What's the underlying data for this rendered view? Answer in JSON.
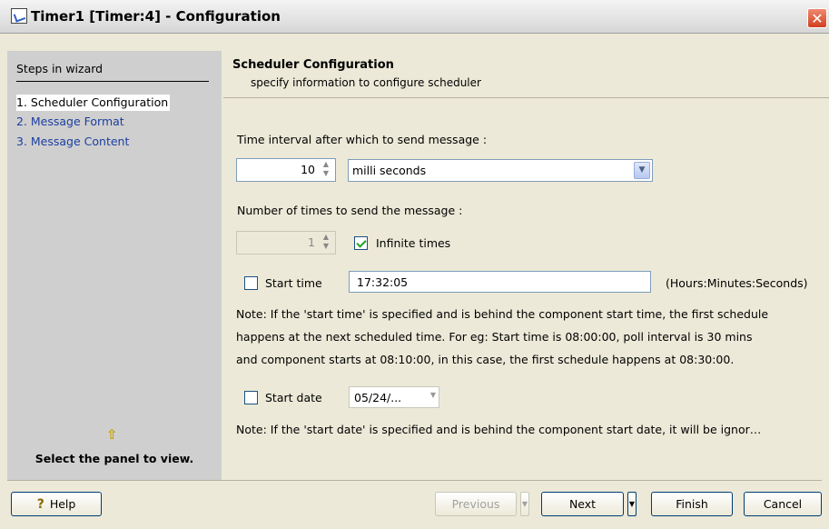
{
  "window": {
    "title": "Timer1 [Timer:4] - Configuration",
    "close_label": "✕"
  },
  "sidebar": {
    "heading": "Steps in wizard",
    "steps": [
      {
        "label": "1. Scheduler Configuration",
        "active": true
      },
      {
        "label": "2. Message Format",
        "active": false
      },
      {
        "label": "3. Message Content",
        "active": false
      }
    ],
    "arrow_icon": "⇧",
    "select_panel_text": "Select the panel to view."
  },
  "header": {
    "title": "Scheduler Configuration",
    "subtitle": "specify information to configure scheduler"
  },
  "form": {
    "interval_label": "Time interval after which to send message :",
    "interval_value": "10",
    "interval_unit": "milli seconds",
    "times_label": "Number of times to send the message :",
    "times_value": "1",
    "infinite_label": "Infinite times",
    "infinite_checked": true,
    "start_time_label": "Start time",
    "start_time_checked": false,
    "start_time_value": "17:32:05",
    "start_time_format": "(Hours:Minutes:Seconds)",
    "start_time_note_lines": [
      "Note: If the 'start time' is specified and is behind the component start time, the first schedule",
      "happens at the next scheduled time. For eg: Start time is 08:00:00, poll interval is 30 mins",
      "and component starts at 08:10:00, in this case, the first schedule happens at 08:30:00."
    ],
    "start_date_label": "Start date",
    "start_date_checked": false,
    "start_date_value": "05/24/...",
    "start_date_note": "Note: If the 'start date' is specified and is behind the component start date, it will be ignor…"
  },
  "footer": {
    "help_label": "Help",
    "previous_label": "Previous",
    "next_label": "Next",
    "finish_label": "Finish",
    "cancel_label": "Cancel"
  },
  "colors": {
    "link": "#1c3fa0",
    "sidebar_bg": "#cfcfcf",
    "dialog_bg": "#ece9d8",
    "close_red": "#d04020"
  }
}
